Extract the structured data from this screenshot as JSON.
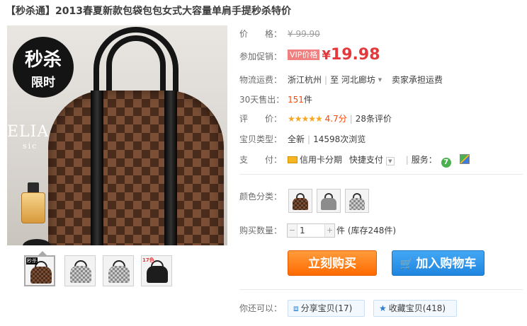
{
  "title": "【秒杀通】2013春夏新款包袋包包女式大容量单肩手提秒杀特价",
  "image": {
    "badge_main": "秒杀",
    "badge_sub": "限时",
    "brand_text": "ELIA",
    "brand_sub": "sic"
  },
  "thumbnails": [
    {
      "tag": "秒杀"
    },
    {
      "tag": ""
    },
    {
      "tag": ""
    },
    {
      "tag": "17色"
    }
  ],
  "info": {
    "price_label": "价　　格：",
    "price_old": "¥ 99.90",
    "promo_label": "参加促销：",
    "vip_tag": "VIP价格",
    "currency": "¥",
    "price_now": "19.98",
    "shipping_label": "物流运费：",
    "ship_from": "浙江杭州",
    "ship_to_word": "至",
    "ship_to": "河北廊坊",
    "ship_fee": "卖家承担运费",
    "sales_label": "30天售出：",
    "sales_count": "151",
    "sales_unit": "件",
    "rating_label": "评　　价：",
    "stars": "★★★★★",
    "rating_score": "4.7分",
    "rating_count": "28条评价",
    "type_label": "宝贝类型：",
    "condition": "全新",
    "views": "14598次浏览",
    "pay_label": "支　　付：",
    "pay_card": "信用卡分期",
    "pay_quick": "快捷支付",
    "service_label": "服务：",
    "service_7": "7"
  },
  "color_label": "颜色分类：",
  "qty_label": "购买数量：",
  "qty_value": "1",
  "qty_stock": "件 (库存248件)",
  "buy_label": "立刻购买",
  "cart_label": "加入购物车",
  "more_label": "你还可以：",
  "share_label": "分享宝贝(17)",
  "fav_label": "收藏宝贝(418)",
  "colors": {
    "accent": "#e4393c",
    "buy": "#ff6a00",
    "cart": "#1f86e0"
  }
}
